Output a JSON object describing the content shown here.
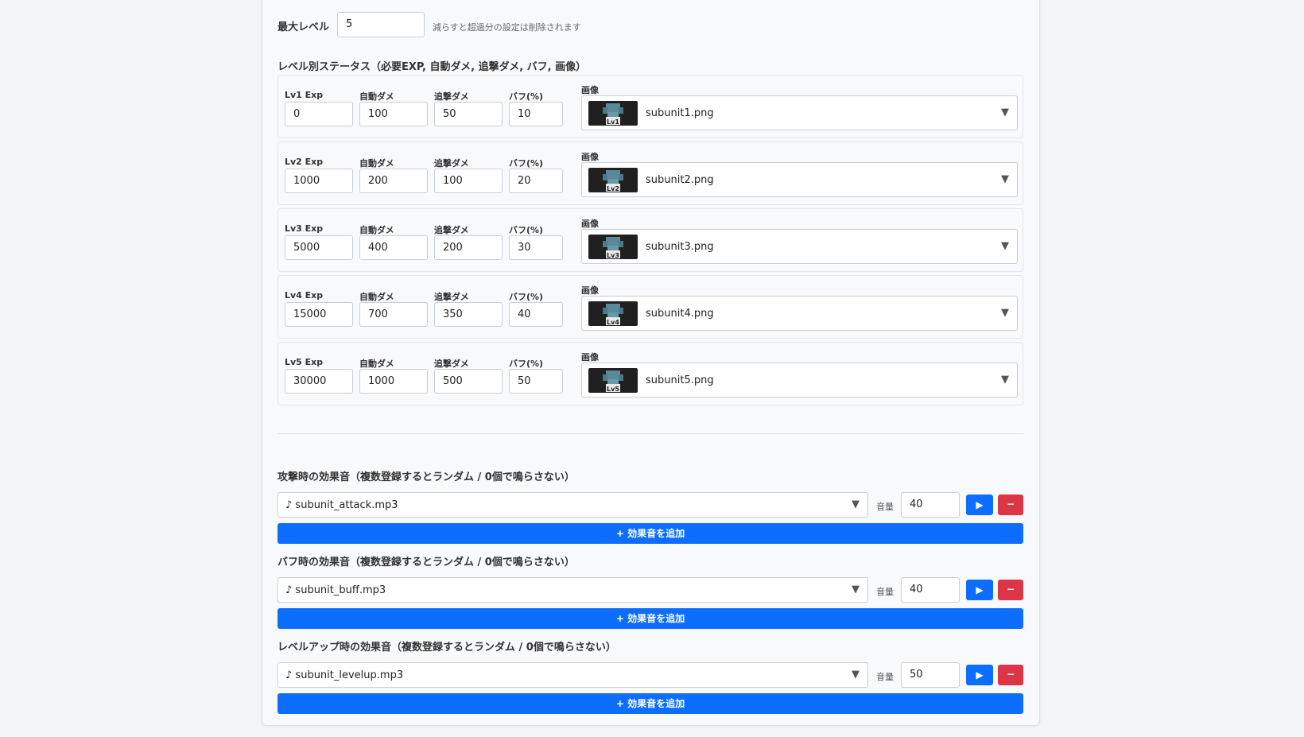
{
  "max_level": {
    "label": "最大レベル",
    "value": "5",
    "hint": "減らすと超過分の設定は削除されます"
  },
  "level_section_title": "レベル別ステータス（必要EXP, 自動ダメ, 追撃ダメ, バフ, 画像）",
  "field_labels": {
    "auto_dmg": "自動ダメ",
    "chase_dmg": "追撃ダメ",
    "buff": "バフ(%)",
    "image": "画像"
  },
  "levels": [
    {
      "exp_label": "Lv1 Exp",
      "exp": "0",
      "auto": "100",
      "chase": "50",
      "buff": "10",
      "image": "subunit1.png",
      "badge": "Lv1"
    },
    {
      "exp_label": "Lv2 Exp",
      "exp": "1000",
      "auto": "200",
      "chase": "100",
      "buff": "20",
      "image": "subunit2.png",
      "badge": "Lv2"
    },
    {
      "exp_label": "Lv3 Exp",
      "exp": "5000",
      "auto": "400",
      "chase": "200",
      "buff": "30",
      "image": "subunit3.png",
      "badge": "Lv3"
    },
    {
      "exp_label": "Lv4 Exp",
      "exp": "15000",
      "auto": "700",
      "chase": "350",
      "buff": "40",
      "image": "subunit4.png",
      "badge": "Lv4"
    },
    {
      "exp_label": "Lv5 Exp",
      "exp": "30000",
      "auto": "1000",
      "chase": "500",
      "buff": "50",
      "image": "subunit5.png",
      "badge": "Lv5"
    }
  ],
  "sound_sections": [
    {
      "title": "攻撃時の効果音（複数登録するとランダム / 0個で鳴らさない）",
      "file": "♪ subunit_attack.mp3",
      "volume": "40"
    },
    {
      "title": "バフ時の効果音（複数登録するとランダム / 0個で鳴らさない）",
      "file": "♪ subunit_buff.mp3",
      "volume": "40"
    },
    {
      "title": "レベルアップ時の効果音（複数登録するとランダム / 0個で鳴らさない）",
      "file": "♪ subunit_levelup.mp3",
      "volume": "50"
    }
  ],
  "sound_labels": {
    "volume": "音量",
    "play": "▶",
    "delete": "−",
    "add": "+ 効果音を追加"
  },
  "icons": {
    "caret": "▼",
    "thumb": "subunit-thumbnail-icon"
  },
  "colors": {
    "primary": "#0d6efd",
    "danger": "#dc3545",
    "thumb_bg": "#202020"
  }
}
